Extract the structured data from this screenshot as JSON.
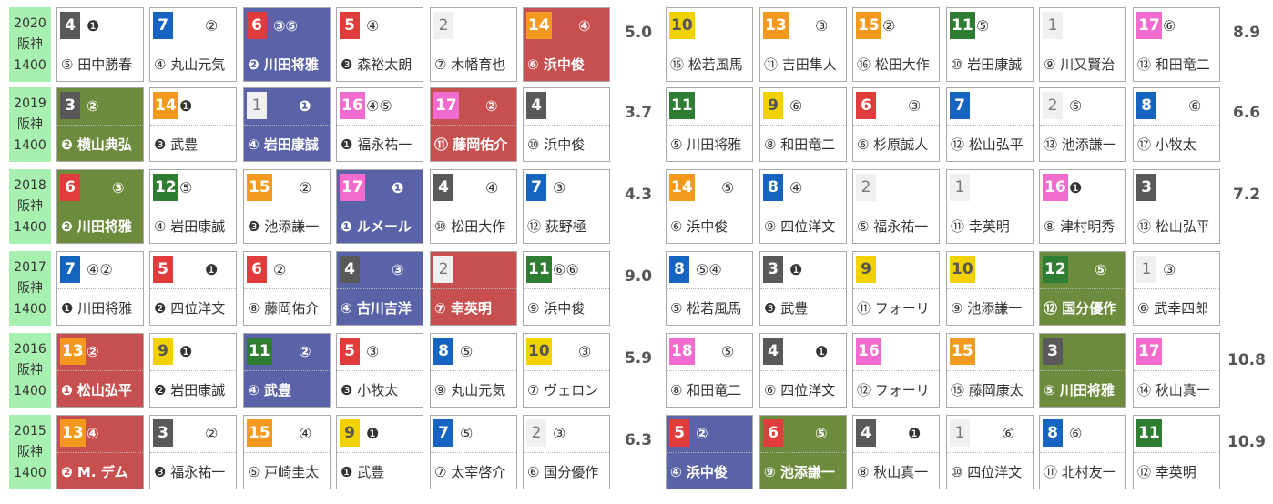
{
  "colors": {
    "red": "#c84f4f",
    "blue": "#5b63a8",
    "green": "#6d8b3d",
    "year_bg": "#a8f0b0"
  },
  "rows": [
    {
      "year": "2020",
      "track": "阪神",
      "dist": "1400",
      "left": [
        {
          "num": "4",
          "m1": "❶",
          "m2": "",
          "jockey": "⑤ 田中勝春",
          "fill": ""
        },
        {
          "num": "7",
          "m1": "",
          "m2": "②",
          "jockey": "④ 丸山元気",
          "fill": ""
        },
        {
          "num": "6",
          "m1": "③⑤",
          "m2": "",
          "jockey": "❷ 川田将雅",
          "fill": "blue"
        },
        {
          "num": "5",
          "m1": "④",
          "m2": "",
          "jockey": "❸ 森裕太朗",
          "fill": ""
        },
        {
          "num": "2",
          "m1": "",
          "m2": "",
          "jockey": "⑦ 木幡育也",
          "fill": ""
        },
        {
          "num": "14",
          "m1": "",
          "m2": "④",
          "jockey": "⑥ 浜中俊",
          "fill": "red"
        }
      ],
      "odds_left": "5.0",
      "right": [
        {
          "num": "10",
          "m1": "",
          "m2": "",
          "jockey": "⑮ 松若風馬",
          "fill": ""
        },
        {
          "num": "13",
          "m1": "",
          "m2": "③",
          "jockey": "⑪ 吉田隼人",
          "fill": ""
        },
        {
          "num": "15",
          "m1": "②",
          "m2": "",
          "jockey": "⑯ 松田大作",
          "fill": ""
        },
        {
          "num": "11",
          "m1": "⑤",
          "m2": "",
          "jockey": "⑩ 岩田康誠",
          "fill": ""
        },
        {
          "num": "1",
          "m1": "",
          "m2": "",
          "jockey": "⑨ 川又賢治",
          "fill": ""
        },
        {
          "num": "17",
          "m1": "⑥",
          "m2": "",
          "jockey": "⑬ 和田竜二",
          "fill": ""
        }
      ],
      "odds_right": "8.9"
    },
    {
      "year": "2019",
      "track": "阪神",
      "dist": "1400",
      "left": [
        {
          "num": "3",
          "m1": "②",
          "m2": "",
          "jockey": "❷ 横山典弘",
          "fill": "green"
        },
        {
          "num": "14",
          "m1": "❶",
          "m2": "",
          "jockey": "❸ 武豊",
          "fill": ""
        },
        {
          "num": "1",
          "m1": "",
          "m2": "❶",
          "jockey": "④ 岩田康誠",
          "fill": "blue"
        },
        {
          "num": "16",
          "m1": "④⑤",
          "m2": "",
          "jockey": "❶ 福永祐一",
          "fill": ""
        },
        {
          "num": "17",
          "m1": "",
          "m2": "②",
          "jockey": "⑪ 藤岡佑介",
          "fill": "red"
        },
        {
          "num": "4",
          "m1": "",
          "m2": "",
          "jockey": "⑩ 浜中俊",
          "fill": ""
        }
      ],
      "odds_left": "3.7",
      "right": [
        {
          "num": "11",
          "m1": "",
          "m2": "",
          "jockey": "⑤ 川田将雅",
          "fill": ""
        },
        {
          "num": "9",
          "m1": "⑥",
          "m2": "",
          "jockey": "⑧ 和田竜二",
          "fill": ""
        },
        {
          "num": "6",
          "m1": "",
          "m2": "③",
          "jockey": "⑥ 杉原誠人",
          "fill": ""
        },
        {
          "num": "7",
          "m1": "",
          "m2": "",
          "jockey": "⑫ 松山弘平",
          "fill": ""
        },
        {
          "num": "2",
          "m1": "⑤",
          "m2": "",
          "jockey": "⑬ 池添謙一",
          "fill": ""
        },
        {
          "num": "8",
          "m1": "",
          "m2": "⑥",
          "jockey": "⑰ 小牧太",
          "fill": ""
        }
      ],
      "odds_right": "6.6"
    },
    {
      "year": "2018",
      "track": "阪神",
      "dist": "1400",
      "left": [
        {
          "num": "6",
          "m1": "",
          "m2": "③",
          "jockey": "❷ 川田将雅",
          "fill": "green"
        },
        {
          "num": "12",
          "m1": "⑤",
          "m2": "",
          "jockey": "④ 岩田康誠",
          "fill": ""
        },
        {
          "num": "15",
          "m1": "",
          "m2": "②",
          "jockey": "❸ 池添謙一",
          "fill": ""
        },
        {
          "num": "17",
          "m1": "",
          "m2": "❶",
          "jockey": "❶ ルメール",
          "fill": "blue"
        },
        {
          "num": "4",
          "m1": "",
          "m2": "④",
          "jockey": "⑩ 松田大作",
          "fill": ""
        },
        {
          "num": "7",
          "m1": "③",
          "m2": "",
          "jockey": "⑫ 荻野極",
          "fill": ""
        }
      ],
      "odds_left": "4.3",
      "right": [
        {
          "num": "14",
          "m1": "",
          "m2": "⑤",
          "jockey": "⑥ 浜中俊",
          "fill": ""
        },
        {
          "num": "8",
          "m1": "④",
          "m2": "",
          "jockey": "⑨ 四位洋文",
          "fill": ""
        },
        {
          "num": "2",
          "m1": "",
          "m2": "",
          "jockey": "⑤ 福永祐一",
          "fill": ""
        },
        {
          "num": "1",
          "m1": "",
          "m2": "",
          "jockey": "⑪ 幸英明",
          "fill": ""
        },
        {
          "num": "16",
          "m1": "❶",
          "m2": "",
          "jockey": "⑧ 津村明秀",
          "fill": ""
        },
        {
          "num": "3",
          "m1": "",
          "m2": "",
          "jockey": "⑬ 松山弘平",
          "fill": ""
        }
      ],
      "odds_right": "7.2"
    },
    {
      "year": "2017",
      "track": "阪神",
      "dist": "1400",
      "left": [
        {
          "num": "7",
          "m1": "④②",
          "m2": "",
          "jockey": "❶ 川田将雅",
          "fill": ""
        },
        {
          "num": "5",
          "m1": "",
          "m2": "❶",
          "jockey": "❷ 四位洋文",
          "fill": ""
        },
        {
          "num": "6",
          "m1": "②",
          "m2": "",
          "jockey": "⑧ 藤岡佑介",
          "fill": ""
        },
        {
          "num": "4",
          "m1": "",
          "m2": "③",
          "jockey": "④ 古川吉洋",
          "fill": "blue"
        },
        {
          "num": "2",
          "m1": "",
          "m2": "",
          "jockey": "⑦ 幸英明",
          "fill": "red"
        },
        {
          "num": "11",
          "m1": "⑥⑥",
          "m2": "",
          "jockey": "⑨ 浜中俊",
          "fill": ""
        }
      ],
      "odds_left": "9.0",
      "right": [
        {
          "num": "8",
          "m1": "⑤④",
          "m2": "",
          "jockey": "⑤ 松若風馬",
          "fill": ""
        },
        {
          "num": "3",
          "m1": "❶",
          "m2": "",
          "jockey": "❸ 武豊",
          "fill": ""
        },
        {
          "num": "9",
          "m1": "",
          "m2": "",
          "jockey": "⑪ フォーリ",
          "fill": ""
        },
        {
          "num": "10",
          "m1": "",
          "m2": "",
          "jockey": "⑨ 池添謙一",
          "fill": ""
        },
        {
          "num": "12",
          "m1": "",
          "m2": "⑤",
          "jockey": "⑫ 国分優作",
          "fill": "green"
        },
        {
          "num": "1",
          "m1": "③",
          "m2": "",
          "jockey": "⑥ 武幸四郎",
          "fill": ""
        }
      ],
      "odds_right": ""
    },
    {
      "year": "2016",
      "track": "阪神",
      "dist": "1400",
      "left": [
        {
          "num": "13",
          "m1": "②",
          "m2": "",
          "jockey": "❶ 松山弘平",
          "fill": "red"
        },
        {
          "num": "9",
          "m1": "❶",
          "m2": "",
          "jockey": "❷ 岩田康誠",
          "fill": ""
        },
        {
          "num": "11",
          "m1": "",
          "m2": "②",
          "jockey": "④ 武豊",
          "fill": "blue"
        },
        {
          "num": "5",
          "m1": "③",
          "m2": "",
          "jockey": "❸ 小牧太",
          "fill": ""
        },
        {
          "num": "8",
          "m1": "⑤",
          "m2": "",
          "jockey": "⑨ 丸山元気",
          "fill": ""
        },
        {
          "num": "10",
          "m1": "",
          "m2": "③",
          "jockey": "⑦ ヴェロン",
          "fill": ""
        }
      ],
      "odds_left": "5.9",
      "right": [
        {
          "num": "18",
          "m1": "",
          "m2": "⑤",
          "jockey": "⑧ 和田竜二",
          "fill": ""
        },
        {
          "num": "4",
          "m1": "",
          "m2": "❶",
          "jockey": "⑥ 四位洋文",
          "fill": ""
        },
        {
          "num": "16",
          "m1": "",
          "m2": "",
          "jockey": "⑫ フォーリ",
          "fill": ""
        },
        {
          "num": "15",
          "m1": "",
          "m2": "",
          "jockey": "⑮ 藤岡康太",
          "fill": ""
        },
        {
          "num": "3",
          "m1": "",
          "m2": "",
          "jockey": "⑤ 川田将雅",
          "fill": "green"
        },
        {
          "num": "17",
          "m1": "",
          "m2": "",
          "jockey": "⑭ 秋山真一",
          "fill": ""
        }
      ],
      "odds_right": "10.8"
    },
    {
      "year": "2015",
      "track": "阪神",
      "dist": "1400",
      "left": [
        {
          "num": "13",
          "m1": "④",
          "m2": "",
          "jockey": "❷ M. デム",
          "fill": "red"
        },
        {
          "num": "3",
          "m1": "",
          "m2": "②",
          "jockey": "❸ 福永祐一",
          "fill": ""
        },
        {
          "num": "15",
          "m1": "",
          "m2": "④",
          "jockey": "⑤ 戸崎圭太",
          "fill": ""
        },
        {
          "num": "9",
          "m1": "❶",
          "m2": "",
          "jockey": "❶ 武豊",
          "fill": ""
        },
        {
          "num": "7",
          "m1": "⑤",
          "m2": "",
          "jockey": "⑦ 太宰啓介",
          "fill": ""
        },
        {
          "num": "2",
          "m1": "③",
          "m2": "",
          "jockey": "⑥ 国分優作",
          "fill": ""
        }
      ],
      "odds_left": "6.3",
      "right": [
        {
          "num": "5",
          "m1": "②",
          "m2": "",
          "jockey": "④ 浜中俊",
          "fill": "blue"
        },
        {
          "num": "6",
          "m1": "",
          "m2": "⑤",
          "jockey": "⑨ 池添謙一",
          "fill": "green"
        },
        {
          "num": "4",
          "m1": "",
          "m2": "❶",
          "jockey": "⑧ 秋山真一",
          "fill": ""
        },
        {
          "num": "1",
          "m1": "",
          "m2": "⑥",
          "jockey": "⑩ 四位洋文",
          "fill": ""
        },
        {
          "num": "8",
          "m1": "⑥",
          "m2": "",
          "jockey": "⑪ 北村友一",
          "fill": ""
        },
        {
          "num": "11",
          "m1": "",
          "m2": "",
          "jockey": "⑫ 幸英明",
          "fill": ""
        }
      ],
      "odds_right": "10.9"
    }
  ]
}
